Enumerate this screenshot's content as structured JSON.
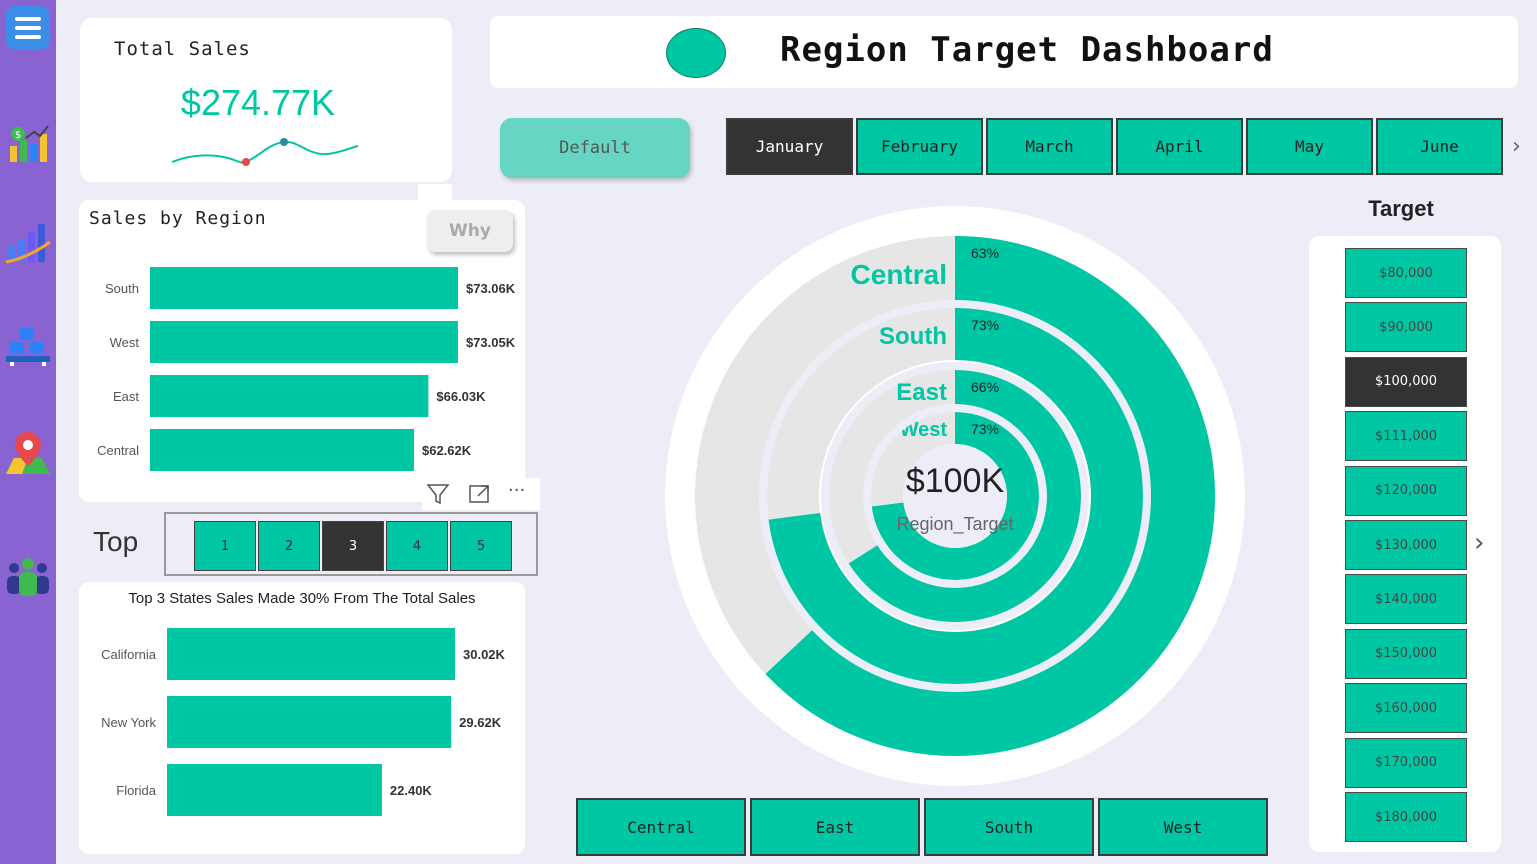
{
  "sidebar": {
    "icons": [
      "menu-icon",
      "sales-chart-icon",
      "growth-chart-icon",
      "boxes-icon",
      "map-pin-icon",
      "team-icon"
    ]
  },
  "kpi": {
    "title": "Total Sales",
    "value": "$274.77K"
  },
  "header": {
    "title": "Region Target Dashboard"
  },
  "default_button": "Default",
  "months": {
    "items": [
      "January",
      "February",
      "March",
      "April",
      "May",
      "June"
    ],
    "selected": "January"
  },
  "sales_by_region": {
    "title": "Sales by Region",
    "why_label": "Why",
    "chart_data": {
      "type": "bar",
      "orientation": "horizontal",
      "categories": [
        "South",
        "West",
        "East",
        "Central"
      ],
      "values": [
        73.06,
        73.05,
        66.03,
        62.62
      ],
      "value_labels": [
        "$73.06K",
        "$73.05K",
        "$66.03K",
        "$62.62K"
      ],
      "unit": "$K",
      "color": "#00c7a3"
    }
  },
  "top_n": {
    "label": "Top",
    "options": [
      "1",
      "2",
      "3",
      "4",
      "5"
    ],
    "selected": "3"
  },
  "top_states": {
    "title": "Top 3 States Sales Made 30% From The Total Sales",
    "chart_data": {
      "type": "bar",
      "orientation": "horizontal",
      "categories": [
        "California",
        "New York",
        "Florida"
      ],
      "values": [
        30.02,
        29.62,
        22.4
      ],
      "value_labels": [
        "30.02K",
        "29.62K",
        "22.40K"
      ],
      "unit": "K",
      "color": "#00c7a3"
    }
  },
  "radial": {
    "center_value": "$100K",
    "center_label": "Region_Target",
    "chart_data": {
      "type": "radial-bar",
      "categories": [
        "Central",
        "South",
        "East",
        "West"
      ],
      "values": [
        63,
        73,
        66,
        73
      ],
      "value_labels": [
        "63%",
        "73%",
        "66%",
        "73%"
      ],
      "unit": "%",
      "color": "#00c7a3",
      "track_color": "#e6e6e6"
    }
  },
  "region_buttons": [
    "Central",
    "East",
    "South",
    "West"
  ],
  "target": {
    "title": "Target",
    "options": [
      "$80,000",
      "$90,000",
      "$100,000",
      "$111,000",
      "$120,000",
      "$130,000",
      "$140,000",
      "$150,000",
      "$160,000",
      "$170,000",
      "$180,000"
    ],
    "selected": "$100,000"
  },
  "colors": {
    "accent": "#00c7a3",
    "sidebar": "#8a63d2",
    "background": "#ecedf6",
    "dark": "#333333"
  }
}
